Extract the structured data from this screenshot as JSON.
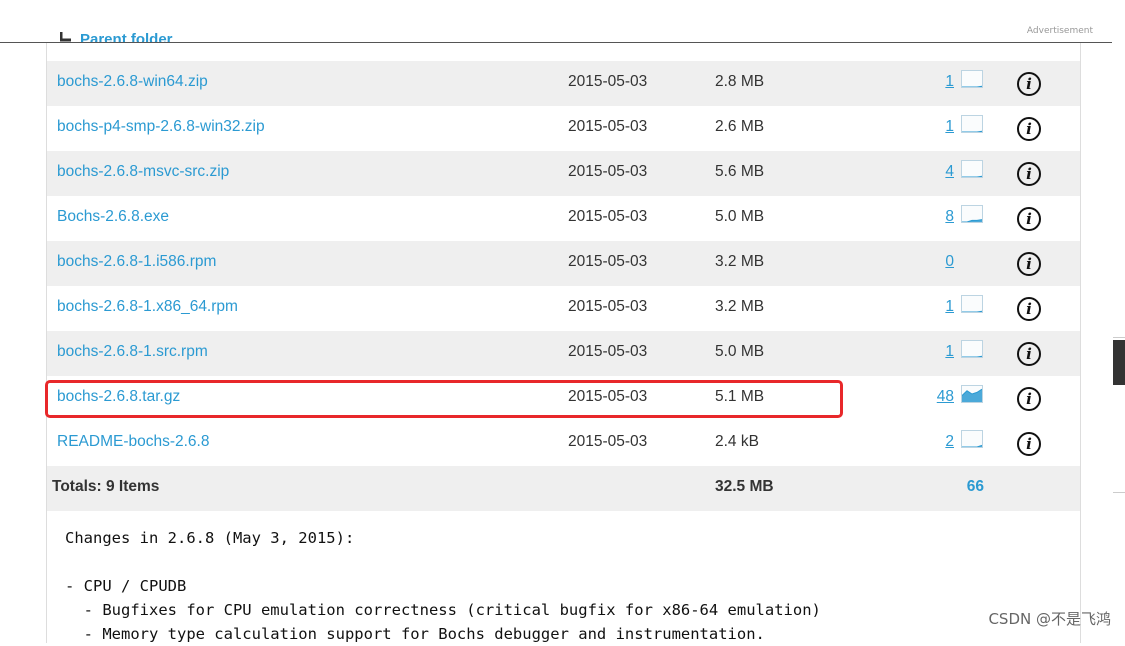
{
  "ad": {
    "label": "Advertisement"
  },
  "parent_folder": {
    "label": "Parent folder"
  },
  "files": [
    {
      "name": "bochs-2.6.8-win64.zip",
      "date": "2015-05-03",
      "size": "2.8 MB",
      "downloads": "1",
      "spark": [
        0,
        0,
        0,
        0,
        0.05
      ]
    },
    {
      "name": "bochs-p4-smp-2.6.8-win32.zip",
      "date": "2015-05-03",
      "size": "2.6 MB",
      "downloads": "1",
      "spark": [
        0,
        0,
        0,
        0,
        0.05
      ]
    },
    {
      "name": "bochs-2.6.8-msvc-src.zip",
      "date": "2015-05-03",
      "size": "5.6 MB",
      "downloads": "4",
      "spark": [
        0,
        0,
        0,
        0,
        0.05
      ]
    },
    {
      "name": "Bochs-2.6.8.exe",
      "date": "2015-05-03",
      "size": "5.0 MB",
      "downloads": "8",
      "spark": [
        0,
        0,
        0.1,
        0.1,
        0.15
      ]
    },
    {
      "name": "bochs-2.6.8-1.i586.rpm",
      "date": "2015-05-03",
      "size": "3.2 MB",
      "downloads": "0",
      "spark": null
    },
    {
      "name": "bochs-2.6.8-1.x86_64.rpm",
      "date": "2015-05-03",
      "size": "3.2 MB",
      "downloads": "1",
      "spark": [
        0,
        0,
        0,
        0,
        0.05
      ]
    },
    {
      "name": "bochs-2.6.8-1.src.rpm",
      "date": "2015-05-03",
      "size": "5.0 MB",
      "downloads": "1",
      "spark": [
        0,
        0,
        0,
        0,
        0.05
      ]
    },
    {
      "name": "bochs-2.6.8.tar.gz",
      "date": "2015-05-03",
      "size": "5.1 MB",
      "downloads": "48",
      "spark": [
        0.4,
        0.7,
        0.5,
        0.6,
        0.8
      ]
    },
    {
      "name": "README-bochs-2.6.8",
      "date": "2015-05-03",
      "size": "2.4 kB",
      "downloads": "2",
      "spark": [
        0,
        0,
        0,
        0,
        0.1
      ]
    }
  ],
  "totals": {
    "label": "Totals: 9 Items",
    "size": "32.5 MB",
    "downloads": "66"
  },
  "info_glyph": "i",
  "highlighted_file": "bochs-2.6.8.tar.gz",
  "changes": {
    "heading": "Changes in 2.6.8 (May 3, 2015):",
    "section": "- CPU / CPUDB",
    "line1": "  - Bugfixes for CPU emulation correctness (critical bugfix for x86-64 emulation)",
    "line2": "  - Memory type calculation support for Bochs debugger and instrumentation."
  },
  "watermark": "CSDN @不是飞鸿",
  "colors": {
    "link": "#2b9ad2",
    "row_shade": "#efefef",
    "highlight": "#e8282a"
  }
}
